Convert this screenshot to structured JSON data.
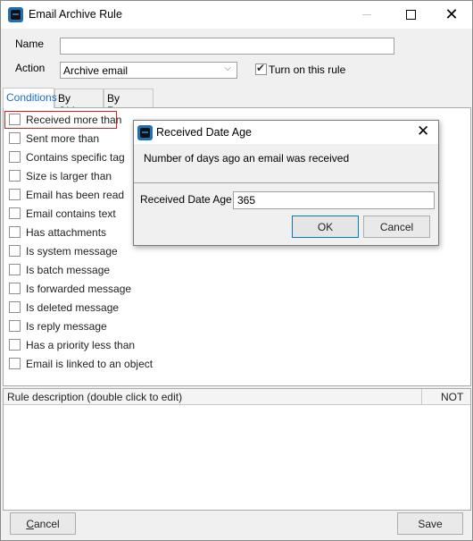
{
  "window": {
    "title": "Email Archive Rule",
    "icon": "app-logo-icon",
    "controls": {
      "minimize": "minimize-icon",
      "maximize": "maximize-icon",
      "close": "close-icon",
      "close_glyph": "✕"
    }
  },
  "form": {
    "name_label": "Name",
    "name_value": "",
    "action_label": "Action",
    "action_value": "Archive email",
    "action_chevron": "⌵",
    "turn_on_label": "Turn on this rule",
    "turn_on_checked": true
  },
  "tabs": [
    {
      "label": "Conditions",
      "active": true
    },
    {
      "label": "By Object",
      "active": false
    },
    {
      "label": "By Report",
      "active": false
    }
  ],
  "conditions": [
    {
      "label": "Received more than",
      "checked": false,
      "highlighted": true
    },
    {
      "label": "Sent more than",
      "checked": false
    },
    {
      "label": "Contains specific tag",
      "checked": false
    },
    {
      "label": "Size is larger than",
      "checked": false
    },
    {
      "label": "Email has been read",
      "checked": false
    },
    {
      "label": "Email contains text",
      "checked": false
    },
    {
      "label": "Has attachments",
      "checked": false
    },
    {
      "label": "Is system message",
      "checked": false
    },
    {
      "label": "Is batch message",
      "checked": false
    },
    {
      "label": "Is forwarded message",
      "checked": false
    },
    {
      "label": "Is deleted message",
      "checked": false
    },
    {
      "label": "Is reply message",
      "checked": false
    },
    {
      "label": "Has a priority less than",
      "checked": false
    },
    {
      "label": "Email is linked to an object",
      "checked": false
    }
  ],
  "rule_grid": {
    "columns": [
      "Rule description (double click to edit)",
      "NOT"
    ],
    "rows": []
  },
  "footer": {
    "cancel_label": "Cancel",
    "cancel_mnemonic": "C",
    "cancel_rest": "ancel",
    "save_label": "Save"
  },
  "dialog": {
    "title": "Received Date Age",
    "close_glyph": "✕",
    "message": "Number of days ago an email was received",
    "field_label": "Received Date Age",
    "field_value": "365",
    "ok_label": "OK",
    "cancel_label": "Cancel"
  },
  "colors": {
    "highlight_border": "#d62020",
    "active_tab_text": "#1a6fc4",
    "ok_button_border": "#0078d7"
  }
}
